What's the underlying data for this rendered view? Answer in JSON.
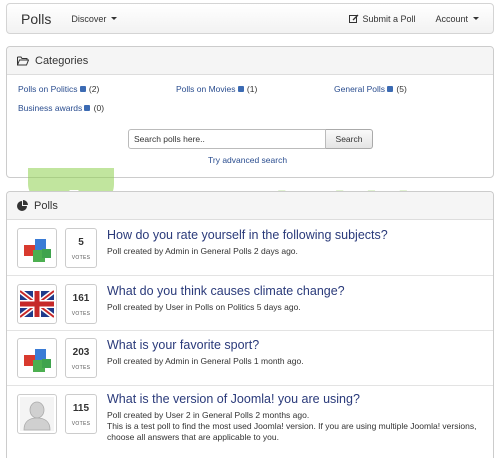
{
  "navbar": {
    "brand": "Polls",
    "discover": "Discover",
    "submit_poll": "Submit a Poll",
    "account": "Account"
  },
  "categories": {
    "title": "Categories",
    "items": [
      {
        "label": "Polls on Politics",
        "count": "(2)"
      },
      {
        "label": "Polls on Movies",
        "count": "(1)"
      },
      {
        "label": "General Polls",
        "count": "(5)"
      },
      {
        "label": "Business awards",
        "count": "(0)"
      }
    ],
    "search_placeholder": "Search polls here..",
    "search_button": "Search",
    "advanced_link": "Try advanced search"
  },
  "polls": {
    "title": "Polls",
    "votes_label": "VOTES",
    "items": [
      {
        "votes": "5",
        "title": "How do you rate yourself in the following subjects?",
        "meta": "Poll created by Admin in General Polls 2 days ago.",
        "icon": "cubes-icon"
      },
      {
        "votes": "161",
        "title": "What do you think causes climate change?",
        "meta": "Poll created by User in Polls on Politics 5 days ago.",
        "icon": "uk-flag-icon"
      },
      {
        "votes": "203",
        "title": "What is your favorite sport?",
        "meta": "Poll created by Admin in General Polls 1 month ago.",
        "icon": "cubes-icon"
      },
      {
        "votes": "115",
        "title": "What is the version of Joomla! you are using?",
        "meta": "Poll created by User 2 in General Polls 2 months ago.",
        "description": "This is a test poll to find the most used Joomla! version. If you are using multiple Joomla! versions, choose all answers that are applicable to you.",
        "icon": "user-avatar-icon"
      }
    ]
  },
  "watermark": {
    "text": "Joomla.bid"
  },
  "colors": {
    "link": "#2a4d8f",
    "title": "#2a3a7a",
    "watermark": "#8fd14f"
  }
}
